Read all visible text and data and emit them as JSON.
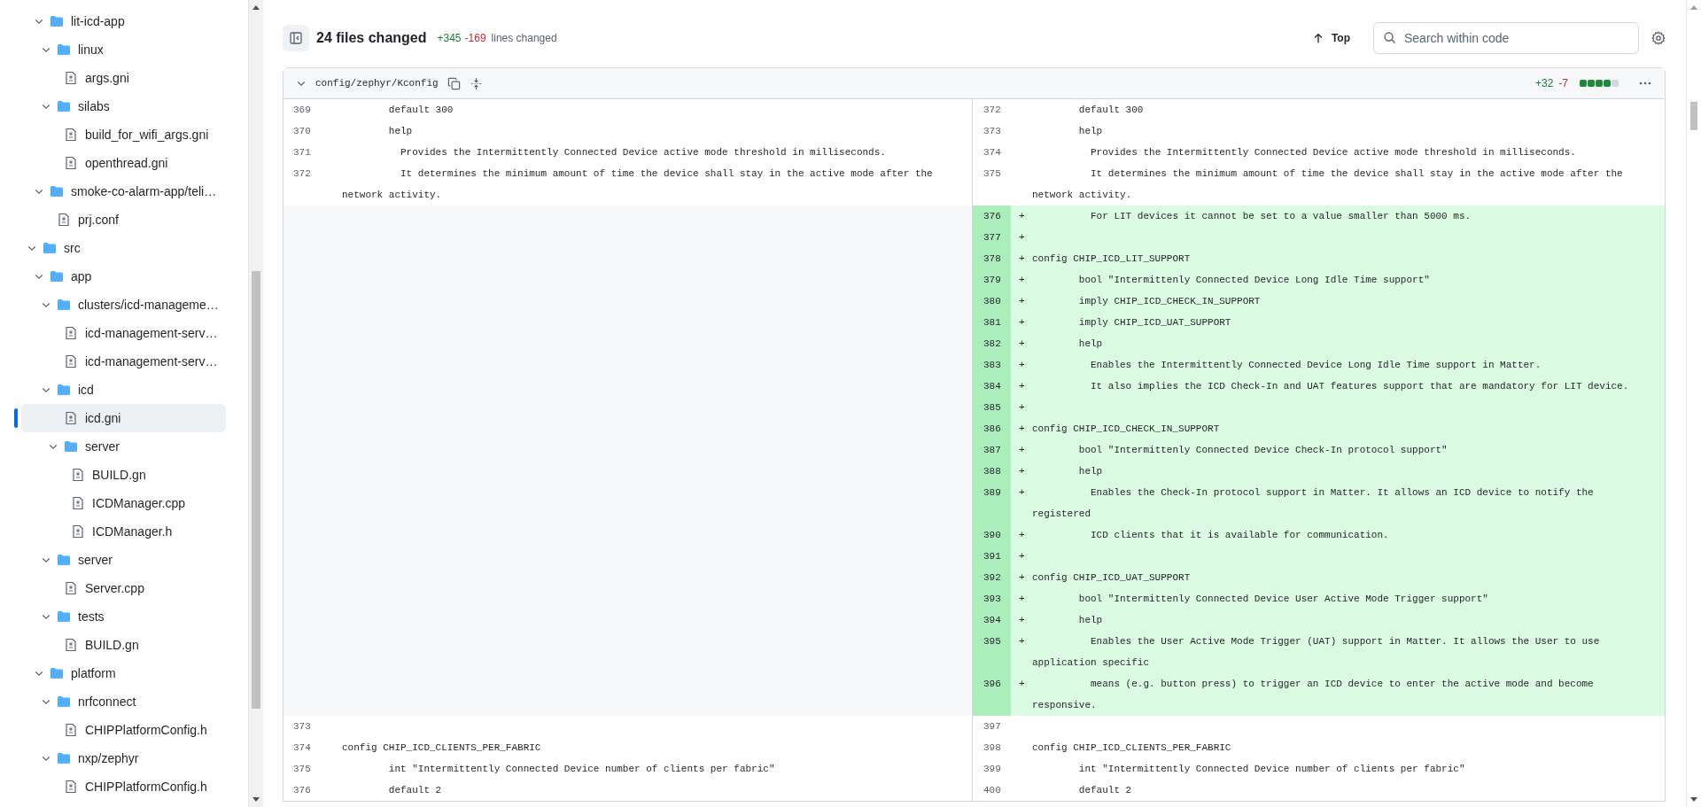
{
  "sidebar": {
    "continued": [
      {
        "label": "lit-icd-app",
        "kind": "folder",
        "expanded": true,
        "selected": false,
        "children": [
          {
            "label": "linux",
            "kind": "folder",
            "expanded": true,
            "selected": false,
            "children": [
              {
                "label": "args.gni",
                "kind": "file",
                "selected": false
              }
            ]
          },
          {
            "label": "silabs",
            "kind": "folder",
            "expanded": true,
            "selected": false,
            "children": [
              {
                "label": "build_for_wifi_args.gni",
                "kind": "file",
                "selected": false
              },
              {
                "label": "openthread.gni",
                "kind": "file",
                "selected": false
              }
            ]
          }
        ]
      },
      {
        "label": "smoke-co-alarm-app/teli…",
        "kind": "folder",
        "expanded": true,
        "selected": false,
        "children": [
          {
            "label": "prj.conf",
            "kind": "file",
            "selected": false
          }
        ]
      }
    ],
    "items": [
      {
        "label": "src",
        "kind": "folder",
        "expanded": true,
        "selected": false,
        "children": [
          {
            "label": "app",
            "kind": "folder",
            "expanded": true,
            "selected": false,
            "children": [
              {
                "label": "clusters/icd-manageme…",
                "kind": "folder",
                "expanded": true,
                "selected": false,
                "children": [
                  {
                    "label": "icd-management-serv…",
                    "kind": "file",
                    "selected": false
                  },
                  {
                    "label": "icd-management-serv…",
                    "kind": "file",
                    "selected": false
                  }
                ]
              },
              {
                "label": "icd",
                "kind": "folder",
                "expanded": true,
                "selected": false,
                "children": [
                  {
                    "label": "icd.gni",
                    "kind": "file",
                    "selected": true
                  },
                  {
                    "label": "server",
                    "kind": "folder",
                    "expanded": true,
                    "selected": false,
                    "children": [
                      {
                        "label": "BUILD.gn",
                        "kind": "file",
                        "selected": false
                      },
                      {
                        "label": "ICDManager.cpp",
                        "kind": "file",
                        "selected": false
                      },
                      {
                        "label": "ICDManager.h",
                        "kind": "file",
                        "selected": false
                      }
                    ]
                  }
                ]
              },
              {
                "label": "server",
                "kind": "folder",
                "expanded": true,
                "selected": false,
                "children": [
                  {
                    "label": "Server.cpp",
                    "kind": "file",
                    "selected": false
                  }
                ]
              },
              {
                "label": "tests",
                "kind": "folder",
                "expanded": true,
                "selected": false,
                "children": [
                  {
                    "label": "BUILD.gn",
                    "kind": "file",
                    "selected": false
                  }
                ]
              }
            ]
          },
          {
            "label": "platform",
            "kind": "folder",
            "expanded": true,
            "selected": false,
            "children": [
              {
                "label": "nrfconnect",
                "kind": "folder",
                "expanded": true,
                "selected": false,
                "children": [
                  {
                    "label": "CHIPPlatformConfig.h",
                    "kind": "file",
                    "selected": false
                  }
                ]
              },
              {
                "label": "nxp/zephyr",
                "kind": "folder",
                "expanded": true,
                "selected": false,
                "children": [
                  {
                    "label": "CHIPPlatformConfig.h",
                    "kind": "file",
                    "selected": false
                  }
                ]
              }
            ]
          }
        ]
      }
    ]
  },
  "toolbar": {
    "title": "24 files changed",
    "additions": "+345",
    "deletions": "-169",
    "caption": "lines changed",
    "top_button": "Top",
    "search": {
      "placeholder": "Search within code"
    }
  },
  "file": {
    "path": "config/zephyr/Kconfig",
    "expanded": true,
    "additions": "+32",
    "deletions": "-7",
    "diffstat": [
      {
        "color": "#1f883d"
      },
      {
        "color": "#1f883d"
      },
      {
        "color": "#1f883d"
      },
      {
        "color": "#1f883d"
      },
      {
        "color": "#d1d9e0"
      }
    ],
    "blocks": [
      {
        "kind": "context",
        "rows": [
          {
            "left": {
              "num": "369",
              "text": "        default 300"
            },
            "right": {
              "num": "372",
              "text": "        default 300"
            }
          },
          {
            "left": {
              "num": "370",
              "text": "        help"
            },
            "right": {
              "num": "373",
              "text": "        help"
            }
          },
          {
            "left": {
              "num": "371",
              "text": "          Provides the Intermittently Connected Device active mode threshold in milliseconds."
            },
            "right": {
              "num": "374",
              "text": "          Provides the Intermittently Connected Device active mode threshold in milliseconds."
            }
          },
          {
            "left": {
              "num": "372",
              "text": "          It determines the minimum amount of time the device shall stay in the active mode after the network activity."
            },
            "right": {
              "num": "375",
              "text": "          It determines the minimum amount of time the device shall stay in the active mode after the network activity."
            }
          }
        ]
      },
      {
        "kind": "added",
        "rows": [
          {
            "num": "376",
            "marker": "+",
            "text": "          For LIT devices it cannot be set to a value smaller than 5000 ms."
          },
          {
            "num": "377",
            "marker": "+"
          },
          {
            "num": "378",
            "marker": "+",
            "text": "config CHIP_ICD_LIT_SUPPORT"
          },
          {
            "num": "379",
            "marker": "+",
            "text": "        bool \"Intermittenly Connected Device Long Idle Time support\""
          },
          {
            "num": "380",
            "marker": "+",
            "text": "        imply CHIP_ICD_CHECK_IN_SUPPORT"
          },
          {
            "num": "381",
            "marker": "+",
            "text": "        imply CHIP_ICD_UAT_SUPPORT"
          },
          {
            "num": "382",
            "marker": "+",
            "text": "        help"
          },
          {
            "num": "383",
            "marker": "+",
            "text": "          Enables the Intermittently Connected Device Long Idle Time support in Matter."
          },
          {
            "num": "384",
            "marker": "+",
            "text": "          It also implies the ICD Check-In and UAT features support that are mandatory for LIT device."
          },
          {
            "num": "385",
            "marker": "+"
          },
          {
            "num": "386",
            "marker": "+",
            "text": "config CHIP_ICD_CHECK_IN_SUPPORT"
          },
          {
            "num": "387",
            "marker": "+",
            "text": "        bool \"Intermittenly Connected Device Check-In protocol support\""
          },
          {
            "num": "388",
            "marker": "+",
            "text": "        help"
          },
          {
            "num": "389",
            "marker": "+",
            "text": "          Enables the Check-In protocol support in Matter. It allows an ICD device to notify the registered"
          },
          {
            "num": "390",
            "marker": "+",
            "text": "          ICD clients that it is available for communication."
          },
          {
            "num": "391",
            "marker": "+"
          },
          {
            "num": "392",
            "marker": "+",
            "text": "config CHIP_ICD_UAT_SUPPORT"
          },
          {
            "num": "393",
            "marker": "+",
            "text": "        bool \"Intermittenly Connected Device User Active Mode Trigger support\""
          },
          {
            "num": "394",
            "marker": "+",
            "text": "        help"
          },
          {
            "num": "395",
            "marker": "+",
            "text": "          Enables the User Active Mode Trigger (UAT) support in Matter. It allows the User to use application specific"
          },
          {
            "num": "396",
            "marker": "+",
            "text": "          means (e.g. button press) to trigger an ICD device to enter the active mode and become responsive."
          }
        ]
      },
      {
        "kind": "context",
        "rows": [
          {
            "left": {
              "num": "373"
            },
            "right": {
              "num": "397"
            }
          },
          {
            "left": {
              "num": "374",
              "text": "config CHIP_ICD_CLIENTS_PER_FABRIC"
            },
            "right": {
              "num": "398",
              "text": "config CHIP_ICD_CLIENTS_PER_FABRIC"
            }
          },
          {
            "left": {
              "num": "375",
              "text": "        int \"Intermittently Connected Device number of clients per fabric\""
            },
            "right": {
              "num": "399",
              "text": "        int \"Intermittently Connected Device number of clients per fabric\""
            }
          },
          {
            "left": {
              "num": "376",
              "text": "        default 2"
            },
            "right": {
              "num": "400",
              "text": "        default 2"
            }
          }
        ]
      }
    ]
  }
}
